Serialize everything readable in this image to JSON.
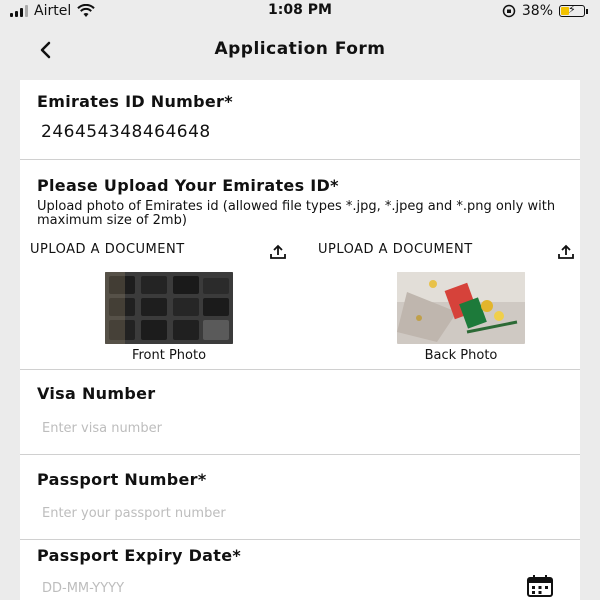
{
  "status_bar": {
    "carrier": "Airtel",
    "time": "1:08 PM",
    "battery": "38%",
    "battery_level": 0.38
  },
  "header": {
    "title": "Application Form",
    "back_icon": "chevron-left-icon"
  },
  "form": {
    "emirates_id": {
      "label": "Emirates ID Number*",
      "value": "246454348464648"
    },
    "upload": {
      "title": "Please Upload Your Emirates ID*",
      "help": "Upload photo of Emirates id (allowed file types *.jpg, *.jpeg and *.png only with maximum size of 2mb)",
      "front": {
        "button": "UPLOAD A DOCUMENT",
        "caption": "Front Photo"
      },
      "back": {
        "button": "UPLOAD A DOCUMENT",
        "caption": "Back Photo"
      }
    },
    "visa": {
      "label": "Visa Number",
      "placeholder": "Enter visa number"
    },
    "passport": {
      "label": "Passport Number*",
      "placeholder": "Enter your passport number"
    },
    "expiry": {
      "label": "Passport Expiry Date*",
      "placeholder": "DD-MM-YYYY",
      "icon": "calendar-icon"
    }
  }
}
